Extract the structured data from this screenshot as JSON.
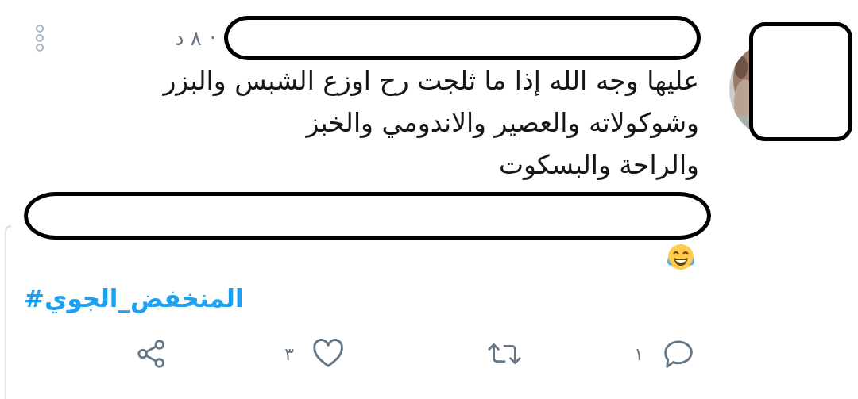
{
  "tweet": {
    "separator": "·",
    "time": "٨ د",
    "text": "عليها وجه الله إذا ما ثلجت رح اوزع الشبس والبزر\nوشوكولاته والعصير والاندومي والخبز\nوالراحة والبسكوت",
    "hashtag": "#المنخفض_الجوي",
    "actions": [
      {
        "kind": "reply",
        "count": "١"
      },
      {
        "kind": "retweet"
      },
      {
        "kind": "like",
        "count": "٣"
      },
      {
        "kind": "share"
      }
    ]
  }
}
